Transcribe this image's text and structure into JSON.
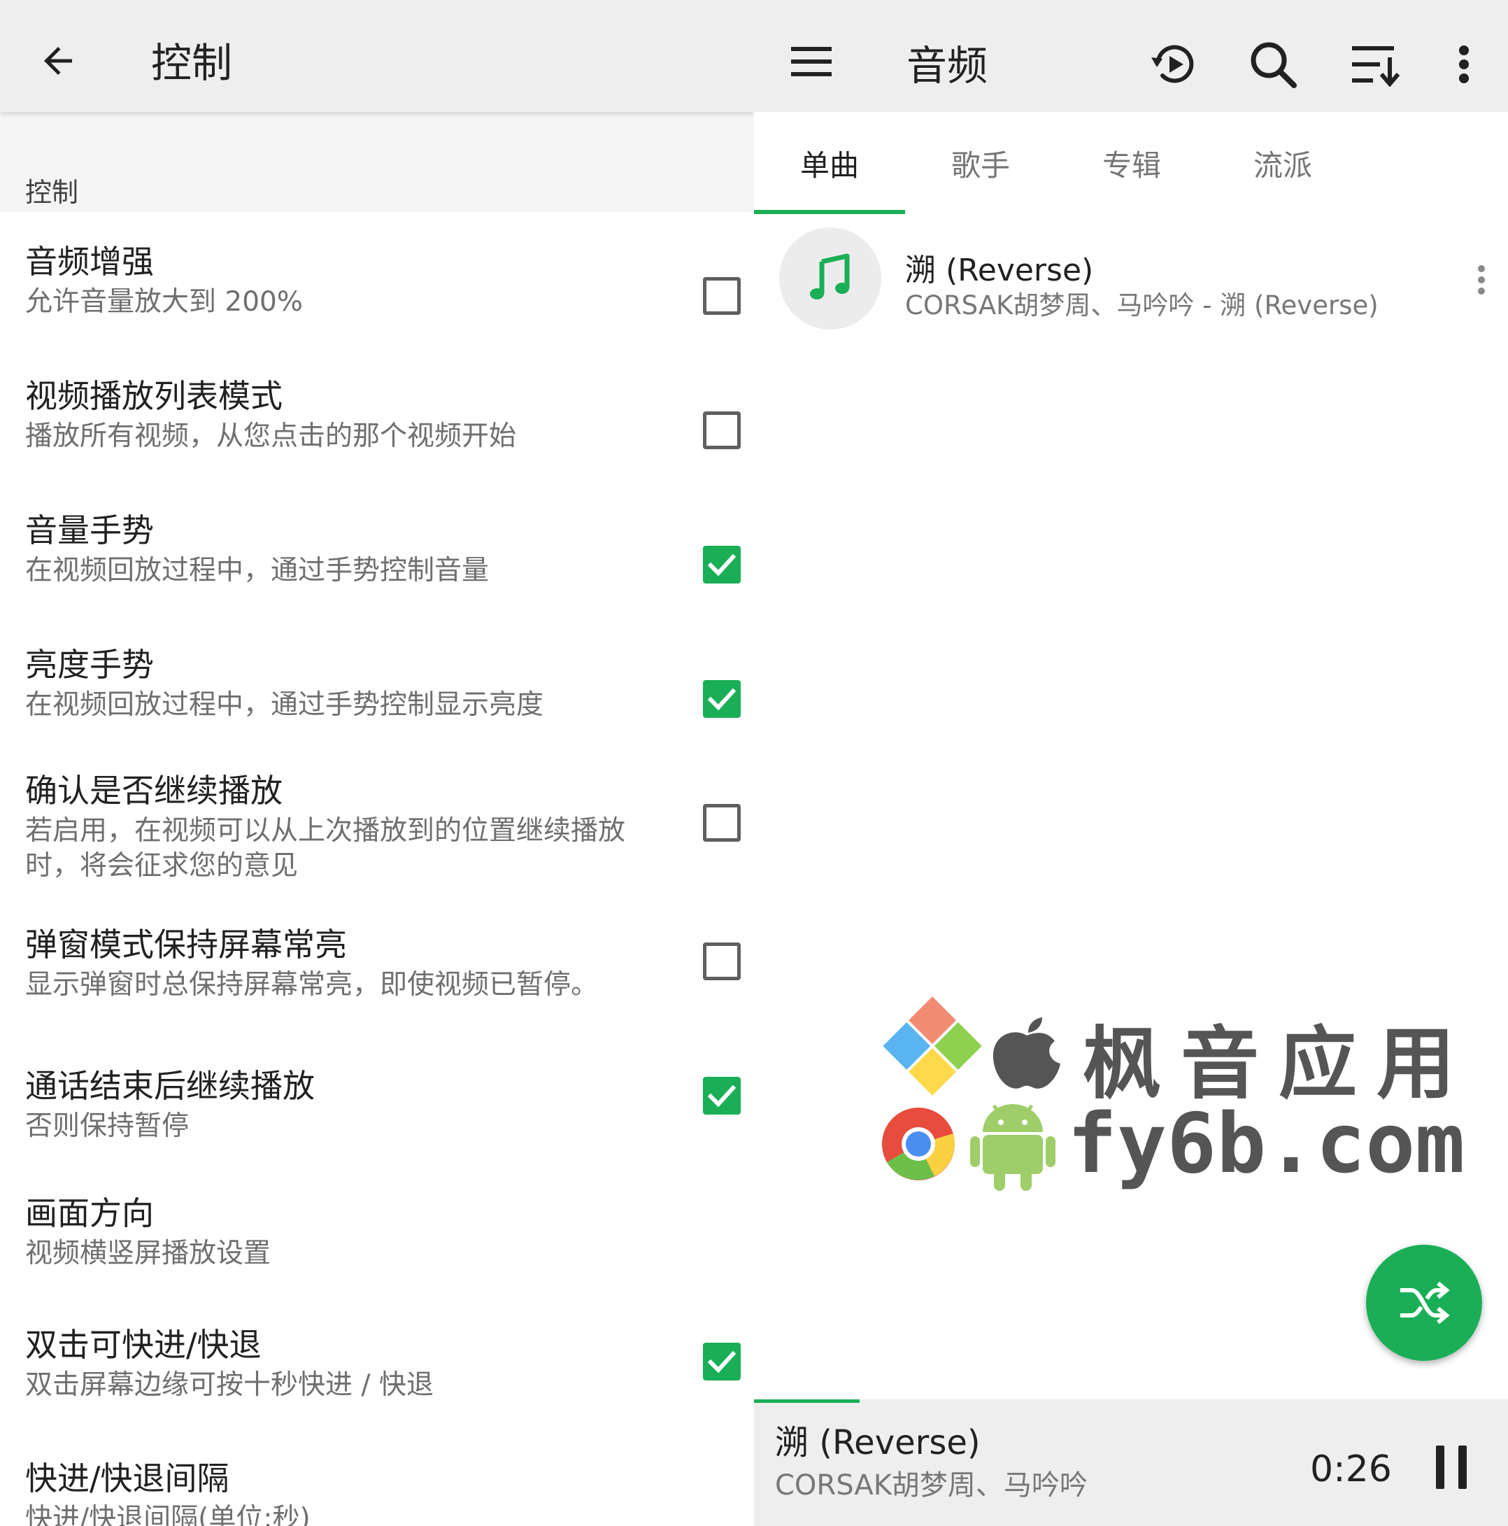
{
  "colors": {
    "accent": "#1aaf56",
    "toolbar": "#eeeeee",
    "subtitle": "#6f6f6f"
  },
  "left": {
    "title": "控制",
    "section_header": "控制",
    "prefs": [
      {
        "title": "音频增强",
        "summary": "允许音量放大到 200%",
        "checkbox": true,
        "checked": false
      },
      {
        "title": "视频播放列表模式",
        "summary": "播放所有视频，从您点击的那个视频开始",
        "checkbox": true,
        "checked": false
      },
      {
        "title": "音量手势",
        "summary": "在视频回放过程中，通过手势控制音量",
        "checkbox": true,
        "checked": true
      },
      {
        "title": "亮度手势",
        "summary": "在视频回放过程中，通过手势控制显示亮度",
        "checkbox": true,
        "checked": true
      },
      {
        "title": "确认是否继续播放",
        "summary": "若启用，在视频可以从上次播放到的位置继续播放时，将会征求您的意见",
        "checkbox": true,
        "checked": false
      },
      {
        "title": "弹窗模式保持屏幕常亮",
        "summary": "显示弹窗时总保持屏幕常亮，即使视频已暂停。",
        "checkbox": true,
        "checked": false
      },
      {
        "title": "通话结束后继续播放",
        "summary": "否则保持暂停",
        "checkbox": true,
        "checked": true
      },
      {
        "title": "画面方向",
        "summary": "视频横竖屏播放设置",
        "checkbox": false,
        "checked": false
      },
      {
        "title": "双击可快进/快退",
        "summary": "双击屏幕边缘可按十秒快进 / 快退",
        "checkbox": true,
        "checked": true
      },
      {
        "title": "快进/快退间隔",
        "summary": "快进/快退间隔(单位:秒)",
        "checkbox": false,
        "checked": false
      }
    ]
  },
  "right": {
    "title": "音频",
    "tabs": [
      "单曲",
      "歌手",
      "专辑",
      "流派"
    ],
    "active_tab": 0,
    "song": {
      "title": "溯 (Reverse)",
      "subtitle": "CORSAK胡梦周、马吟吟 - 溯 (Reverse)"
    },
    "mini_player": {
      "title": "溯 (Reverse)",
      "artist": "CORSAK胡梦周、马吟吟",
      "time": "0:26",
      "progress": 0.14
    },
    "watermark": {
      "text_cn": "枫音应用",
      "text_en": "fy6b.com"
    }
  }
}
